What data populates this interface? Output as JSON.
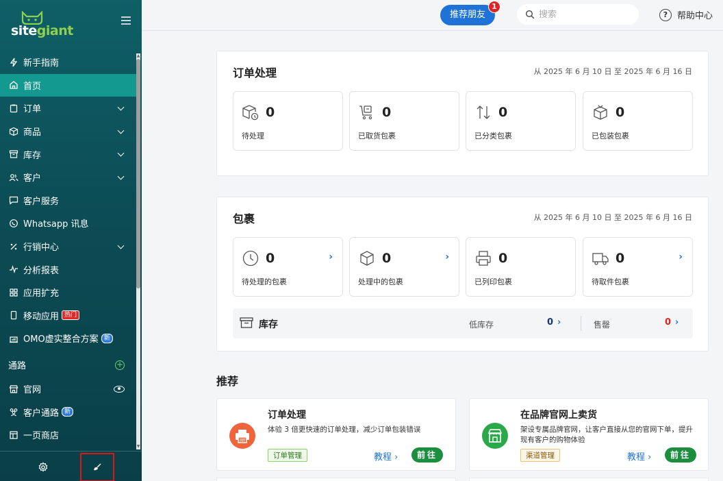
{
  "brand": {
    "name_part1": "site",
    "name_part2": "giant"
  },
  "sidebar": {
    "items": [
      {
        "label": "新手指南",
        "icon": "bolt-icon",
        "chevron": false,
        "active": false
      },
      {
        "label": "首页",
        "icon": "home-icon",
        "chevron": false,
        "active": true
      },
      {
        "label": "订单",
        "icon": "clipboard-icon",
        "chevron": true,
        "active": false
      },
      {
        "label": "商品",
        "icon": "box-icon",
        "chevron": true,
        "active": false
      },
      {
        "label": "库存",
        "icon": "archive-icon",
        "chevron": true,
        "active": false
      },
      {
        "label": "客户",
        "icon": "users-icon",
        "chevron": true,
        "active": false
      },
      {
        "label": "客户服务",
        "icon": "chat-icon",
        "chevron": false,
        "active": false
      },
      {
        "label": "Whatsapp 讯息",
        "icon": "whatsapp-icon",
        "chevron": false,
        "active": false
      },
      {
        "label": "行销中心",
        "icon": "percent-icon",
        "chevron": true,
        "active": false
      },
      {
        "label": "分析报表",
        "icon": "pulse-icon",
        "chevron": false,
        "active": false
      },
      {
        "label": "应用扩充",
        "icon": "grid-icon",
        "chevron": false,
        "active": false
      },
      {
        "label": "移动应用",
        "icon": "mobile-icon",
        "chevron": false,
        "active": false,
        "badge": "热门"
      },
      {
        "label": "OMO虚实整合方案",
        "icon": "store-chart-icon",
        "chevron": false,
        "active": false,
        "badge": "新"
      }
    ],
    "channels_label": "通路",
    "channel_items": [
      {
        "label": "官网",
        "icon": "storefront-icon"
      },
      {
        "label": "客户通路",
        "icon": "people-icon",
        "badge": "新"
      },
      {
        "label": "一页商店",
        "icon": "page-icon"
      }
    ]
  },
  "topbar": {
    "invite_label": "推荐朋友",
    "invite_badge": "1",
    "search_placeholder": "搜索",
    "help_label": "帮助中心"
  },
  "orders_panel": {
    "title": "订单处理",
    "date_range": "从 2025 年 6 月 10 日 至 2025 年 6 月 16 日",
    "cards": [
      {
        "value": "0",
        "label": "待处理",
        "icon": "box-clock-icon"
      },
      {
        "value": "0",
        "label": "已取货包裹",
        "icon": "cart-icon"
      },
      {
        "value": "0",
        "label": "已分类包裹",
        "icon": "sort-arrows-icon"
      },
      {
        "value": "0",
        "label": "已包装包裹",
        "icon": "package-icon"
      }
    ]
  },
  "parcels_panel": {
    "title": "包裹",
    "date_range": "从 2025 年 6 月 10 日 至 2025 年 6 月 16 日",
    "cards": [
      {
        "value": "0",
        "label": "待处理的包裹",
        "icon": "clock-icon",
        "arrow": true
      },
      {
        "value": "0",
        "label": "处理中的包裹",
        "icon": "cube-icon",
        "arrow": true
      },
      {
        "value": "0",
        "label": "已列印包裹",
        "icon": "printer-icon",
        "arrow": false
      },
      {
        "value": "0",
        "label": "待取件包裹",
        "icon": "truck-icon",
        "arrow": true
      }
    ],
    "stock": {
      "title": "库存",
      "low_label": "低库存",
      "low_value": "0",
      "sold_label": "售罄",
      "sold_value": "0"
    }
  },
  "recommend": {
    "title": "推荐",
    "cards": [
      {
        "title": "订单处理",
        "desc": "体验 3 倍更快速的订单处理，减少订单包装错误",
        "tag": "订单管理",
        "tutorial": "教程",
        "go": "前往",
        "icon": "printer-icon",
        "icon_color": "#f0643c"
      },
      {
        "title": "在品牌官网上卖货",
        "desc": "架设专属品牌官网，让客户直接从您的官网下单，提升现有客户的购物体验",
        "tag": "渠道管理",
        "tutorial": "教程",
        "go": "前往",
        "icon": "storefront-icon",
        "icon_color": "#2aa84a"
      }
    ]
  },
  "colors": {
    "sidebar_bg": "#0c4c55",
    "active_item": "#13998f",
    "primary": "#1f73d6",
    "go_button": "#1c8f3e",
    "danger": "#e02424"
  }
}
